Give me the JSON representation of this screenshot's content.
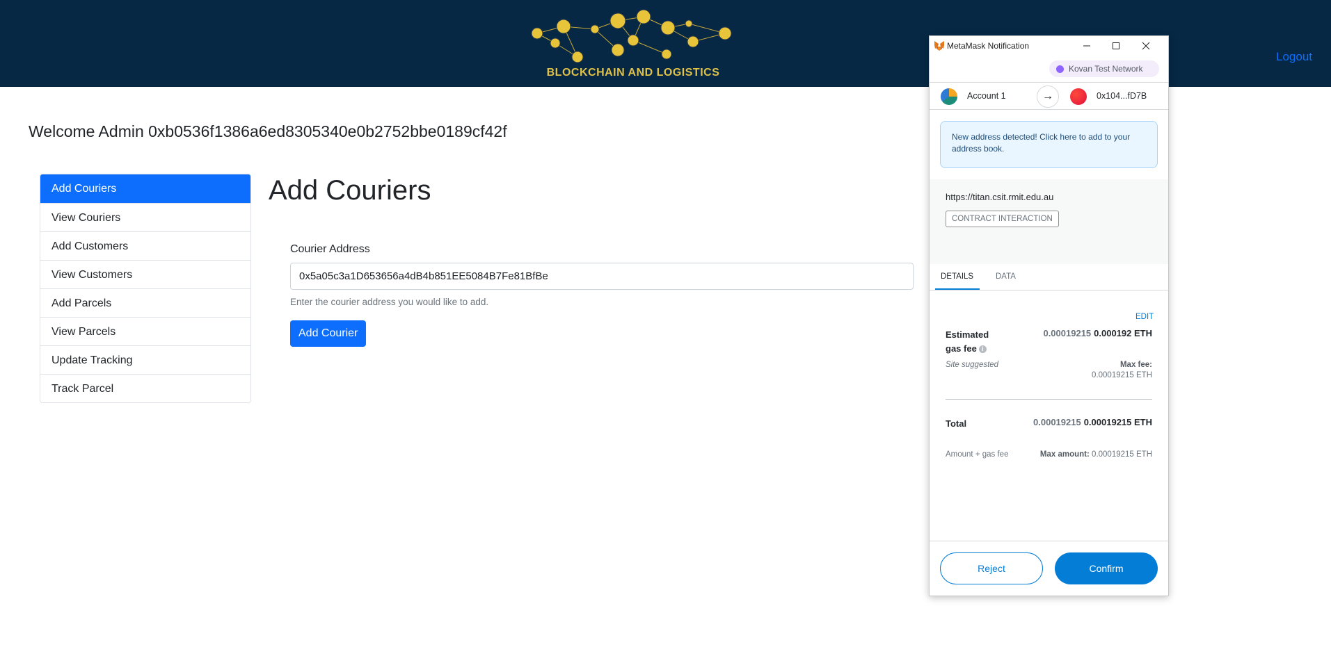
{
  "header": {
    "logo_text": "BLOCKCHAIN AND LOGISTICS",
    "logout_label": "Logout"
  },
  "welcome": {
    "text": "Welcome Admin 0xb0536f1386a6ed8305340e0b2752bbe0189cf42f"
  },
  "sidebar": {
    "items": [
      {
        "label": "Add Couriers",
        "active": true
      },
      {
        "label": "View Couriers"
      },
      {
        "label": "Add Customers"
      },
      {
        "label": "View Customers"
      },
      {
        "label": "Add Parcels"
      },
      {
        "label": "View Parcels"
      },
      {
        "label": "Update Tracking"
      },
      {
        "label": "Track Parcel"
      }
    ]
  },
  "main": {
    "title": "Add Couriers",
    "field_label": "Courier Address",
    "field_value": "0x5a05c3a1D653656a4dB4b851EE5084B7Fe81BfBe",
    "help_text": "Enter the courier address you would like to add.",
    "submit_label": "Add Courier"
  },
  "metamask": {
    "window_title": "MetaMask Notification",
    "network": "Kovan Test Network",
    "from_account": "Account 1",
    "to_account": "0x104...fD7B",
    "alert": "New address detected! Click here to add to your address book.",
    "origin": "https://titan.csit.rmit.edu.au",
    "badge": "CONTRACT INTERACTION",
    "tabs": {
      "details": "DETAILS",
      "data": "DATA"
    },
    "edit_label": "EDIT",
    "gas": {
      "label": "Estimated gas fee",
      "value_muted": "0.00019215",
      "value": "0.000192 ETH",
      "site_suggested": "Site suggested",
      "max_fee_label": "Max fee:",
      "max_fee_value": "0.00019215 ETH"
    },
    "total": {
      "label": "Total",
      "value_muted": "0.00019215",
      "value": "0.00019215 ETH",
      "amount_gas": "Amount + gas fee",
      "max_amount_label": "Max amount:",
      "max_amount_value": "0.00019215 ETH"
    },
    "reject_label": "Reject",
    "confirm_label": "Confirm"
  },
  "colors": {
    "header_bg": "#062844",
    "primary": "#0d6efd",
    "metamask_blue": "#037dd6",
    "logo_gold": "#e0c24a"
  }
}
